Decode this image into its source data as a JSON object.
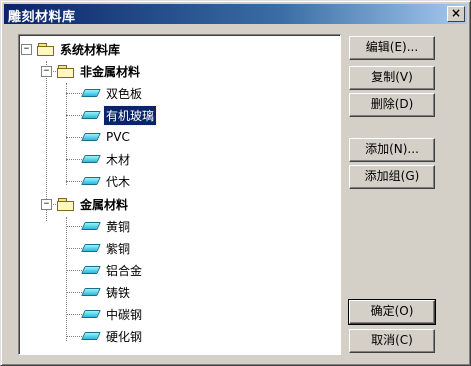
{
  "window": {
    "title": "雕刻材料库"
  },
  "close_label": "×",
  "tree": {
    "root": {
      "label": "系统材料库",
      "expander": "−"
    },
    "groups": [
      {
        "label": "非金属材料",
        "expander": "−",
        "items": [
          "双色板",
          "有机玻璃",
          "PVC",
          "木材",
          "代木"
        ]
      },
      {
        "label": "金属材料",
        "expander": "−",
        "items": [
          "黄铜",
          "紫铜",
          "铝合金",
          "铸铁",
          "中碳钢",
          "硬化钢"
        ]
      }
    ],
    "selected_item": "有机玻璃"
  },
  "buttons": {
    "edit": "编辑(E)...",
    "copy": "复制(V)",
    "delete": "删除(D)",
    "add": "添加(N)...",
    "add_group": "添加组(G)",
    "ok": "确定(O)",
    "cancel": "取消(C)"
  }
}
